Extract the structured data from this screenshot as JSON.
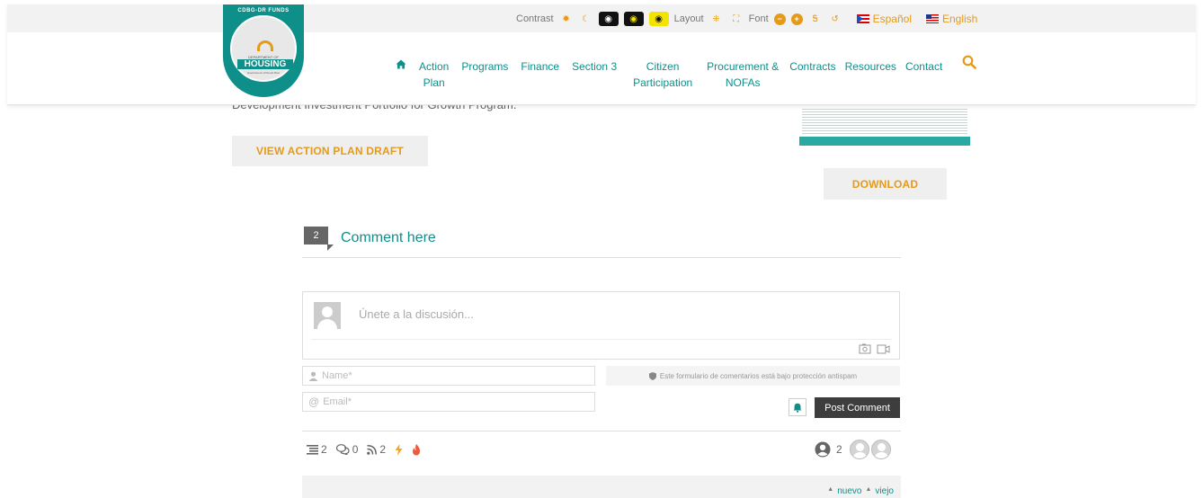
{
  "a11y": {
    "contrast_label": "Contrast",
    "layout_label": "Layout",
    "font_label": "Font",
    "lang_es": "Español",
    "lang_en": "English"
  },
  "logo": {
    "top_text": "CDBG-DR FUNDS",
    "dept_text": "DEPARTMENT OF",
    "housing_text": "HOUSING",
    "sub_text": "Government of Puerto Rico"
  },
  "nav": {
    "items": [
      {
        "line1": "Action",
        "line2": "Plan"
      },
      {
        "line1": "Programs",
        "line2": ""
      },
      {
        "line1": "Finance",
        "line2": ""
      },
      {
        "line1": "Section 3",
        "line2": ""
      },
      {
        "line1": "Citizen",
        "line2": "Participation"
      },
      {
        "line1": "Procurement &",
        "line2": "NOFAs"
      },
      {
        "line1": "Contracts",
        "line2": ""
      },
      {
        "line1": "Resources",
        "line2": ""
      },
      {
        "line1": "Contact",
        "line2": ""
      }
    ]
  },
  "content": {
    "cut_text": "Development Investment Portfolio for Growth Program.",
    "view_button": "VIEW ACTION PLAN DRAFT",
    "download_button": "DOWNLOAD"
  },
  "comments": {
    "count": "2",
    "title": "Comment here",
    "editor_placeholder": "Únete a la discusión...",
    "name_placeholder": "Name*",
    "email_placeholder": "Email*",
    "antispam_text": "Este formulario de comentarios está bajo protección antispam",
    "post_button": "Post Comment",
    "stats": {
      "threads": "2",
      "replies": "0",
      "followers": "2"
    },
    "authors_count": "2",
    "sort_new": "nuevo",
    "sort_old": "viejo"
  },
  "colors": {
    "brand_teal": "#0e8f8a",
    "accent_orange": "#e59a1a",
    "button_dark": "#3d3d3d"
  }
}
